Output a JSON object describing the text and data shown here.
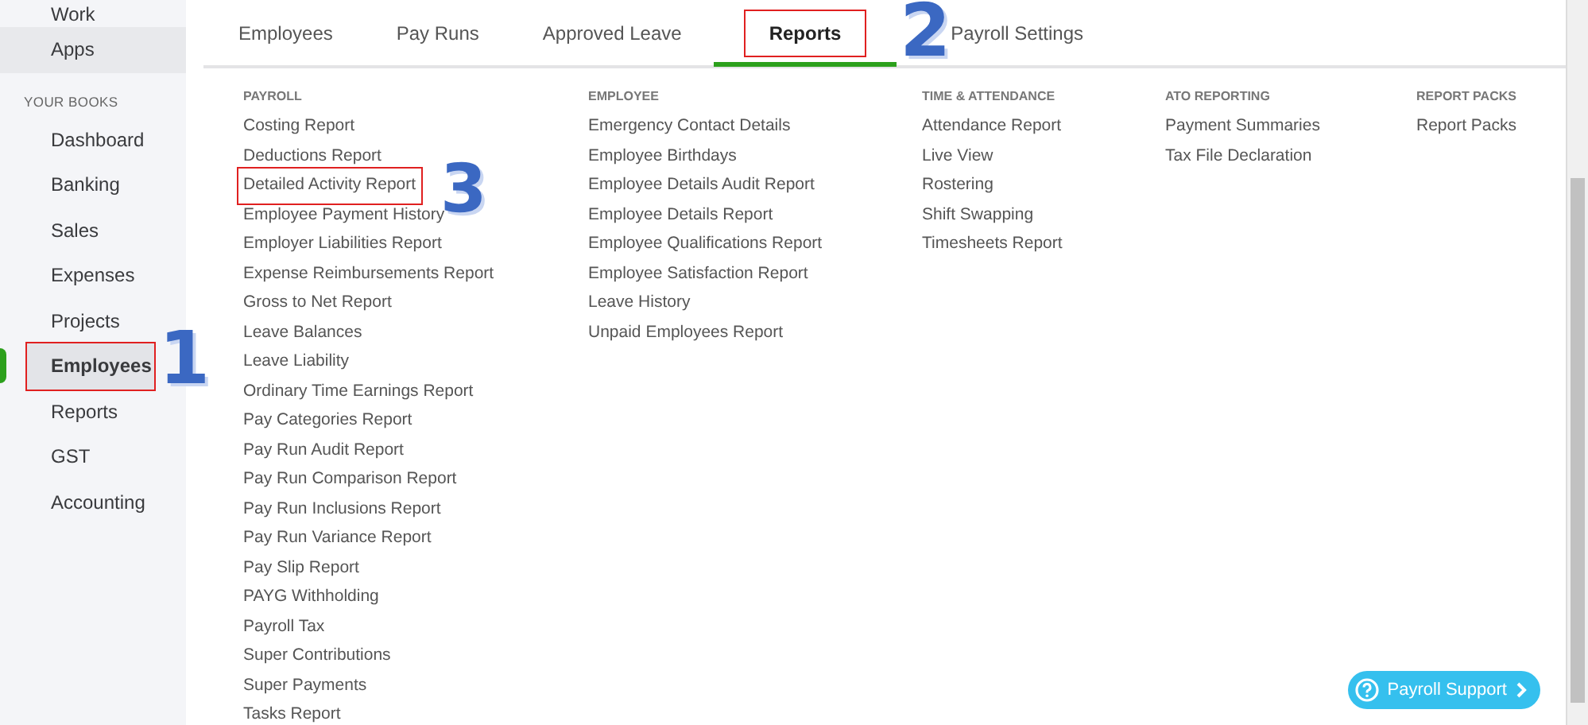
{
  "sidebar": {
    "items": [
      {
        "kind": "item",
        "label": "Work",
        "selected": false,
        "hovered": false,
        "highlighted": false
      },
      {
        "kind": "item",
        "label": "Apps",
        "selected": false,
        "hovered": true,
        "highlighted": false
      },
      {
        "kind": "section",
        "label": "YOUR BOOKS"
      },
      {
        "kind": "item",
        "label": "Dashboard",
        "selected": false,
        "hovered": false,
        "highlighted": false
      },
      {
        "kind": "item",
        "label": "Banking",
        "selected": false,
        "hovered": false,
        "highlighted": false
      },
      {
        "kind": "item",
        "label": "Sales",
        "selected": false,
        "hovered": false,
        "highlighted": false
      },
      {
        "kind": "item",
        "label": "Expenses",
        "selected": false,
        "hovered": false,
        "highlighted": false
      },
      {
        "kind": "item",
        "label": "Projects",
        "selected": false,
        "hovered": false,
        "highlighted": false
      },
      {
        "kind": "item",
        "label": "Employees",
        "selected": true,
        "hovered": false,
        "highlighted": true,
        "annotation": "1"
      },
      {
        "kind": "item",
        "label": "Reports",
        "selected": false,
        "hovered": false,
        "highlighted": false
      },
      {
        "kind": "item",
        "label": "GST",
        "selected": false,
        "hovered": false,
        "highlighted": false
      },
      {
        "kind": "item",
        "label": "Accounting",
        "selected": false,
        "hovered": false,
        "highlighted": false
      }
    ]
  },
  "tabs": [
    {
      "label": "Employees",
      "selected": false,
      "highlighted": false
    },
    {
      "label": "Pay Runs",
      "selected": false,
      "highlighted": false
    },
    {
      "label": "Approved Leave",
      "selected": false,
      "highlighted": false
    },
    {
      "label": "Reports",
      "selected": true,
      "highlighted": true,
      "annotation": "2"
    },
    {
      "label": "Payroll Settings",
      "selected": false,
      "highlighted": false
    }
  ],
  "report_columns": [
    {
      "heading": "PAYROLL",
      "items": [
        {
          "label": "Costing Report"
        },
        {
          "label": "Deductions Report"
        },
        {
          "label": "Detailed Activity Report",
          "highlighted": true,
          "annotation": "3"
        },
        {
          "label": "Employee Payment History"
        },
        {
          "label": "Employer Liabilities Report"
        },
        {
          "label": "Expense Reimbursements Report"
        },
        {
          "label": "Gross to Net Report"
        },
        {
          "label": "Leave Balances"
        },
        {
          "label": "Leave Liability"
        },
        {
          "label": "Ordinary Time Earnings Report"
        },
        {
          "label": "Pay Categories Report"
        },
        {
          "label": "Pay Run Audit Report"
        },
        {
          "label": "Pay Run Comparison Report"
        },
        {
          "label": "Pay Run Inclusions Report"
        },
        {
          "label": "Pay Run Variance Report"
        },
        {
          "label": "Pay Slip Report"
        },
        {
          "label": "PAYG Withholding"
        },
        {
          "label": "Payroll Tax"
        },
        {
          "label": "Super Contributions"
        },
        {
          "label": "Super Payments"
        },
        {
          "label": "Tasks Report"
        }
      ]
    },
    {
      "heading": "EMPLOYEE",
      "items": [
        {
          "label": "Emergency Contact Details"
        },
        {
          "label": "Employee Birthdays"
        },
        {
          "label": "Employee Details Audit Report"
        },
        {
          "label": "Employee Details Report"
        },
        {
          "label": "Employee Qualifications Report"
        },
        {
          "label": "Employee Satisfaction Report"
        },
        {
          "label": "Leave History"
        },
        {
          "label": "Unpaid Employees Report"
        }
      ]
    },
    {
      "heading": "TIME & ATTENDANCE",
      "items": [
        {
          "label": "Attendance Report"
        },
        {
          "label": "Live View"
        },
        {
          "label": "Rostering"
        },
        {
          "label": "Shift Swapping"
        },
        {
          "label": "Timesheets Report"
        }
      ]
    },
    {
      "heading": "ATO REPORTING",
      "items": [
        {
          "label": "Payment Summaries"
        },
        {
          "label": "Tax File Declaration"
        }
      ]
    },
    {
      "heading": "REPORT PACKS",
      "items": [
        {
          "label": "Report Packs"
        }
      ]
    }
  ],
  "support_button": {
    "label": "Payroll Support"
  }
}
